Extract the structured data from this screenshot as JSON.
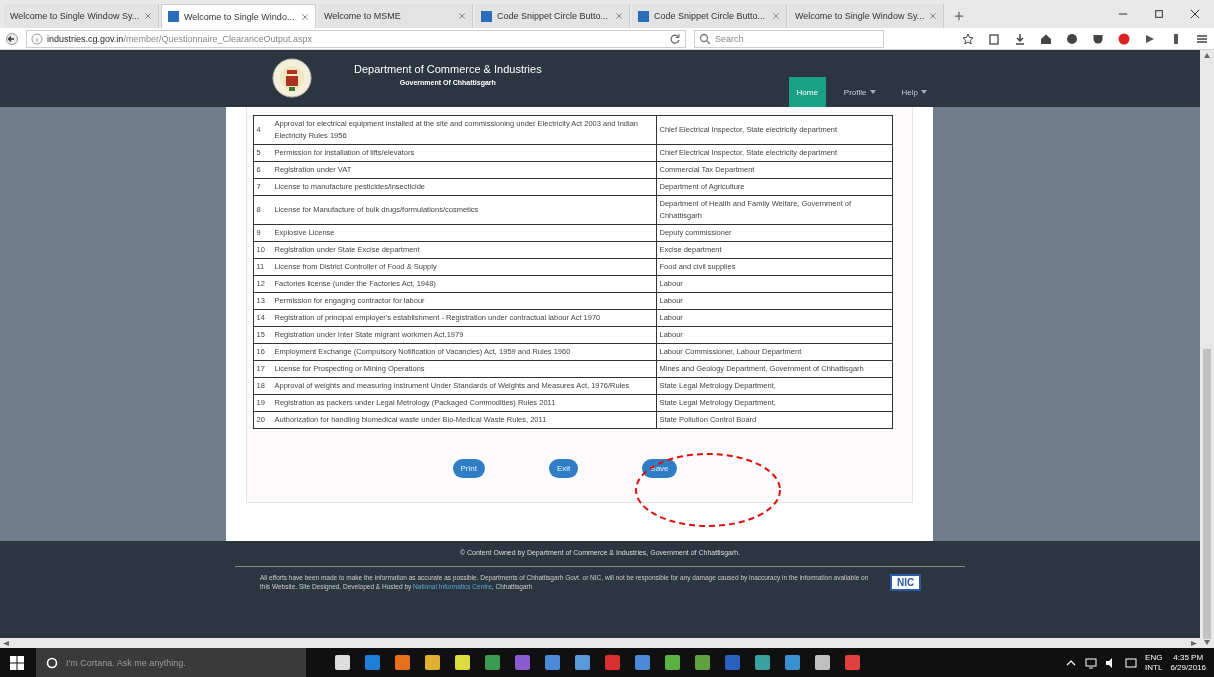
{
  "browser": {
    "tabs": [
      {
        "title": "Welcome to Single Window Sy...",
        "selected": false,
        "favicon": false
      },
      {
        "title": "Welcome to Single Windo...",
        "selected": true,
        "favicon": true
      },
      {
        "title": "Welcome to MSME",
        "selected": false,
        "favicon": false
      },
      {
        "title": "Code Snippet Circle Butto...",
        "selected": false,
        "favicon": true
      },
      {
        "title": "Code Snippet Circle Butto...",
        "selected": false,
        "favicon": true
      },
      {
        "title": "Welcome to Single Window Sy...",
        "selected": false,
        "favicon": false
      }
    ],
    "url_host": "industries.cg.gov.in",
    "url_path": "/member/Questionnaire_ClearanceOutput.aspx",
    "search_placeholder": "Search"
  },
  "header": {
    "title": "Department of Commerce & Industries",
    "subtitle": "Government Of Chhattisgarh",
    "nav": [
      {
        "label": "Home",
        "selected": true,
        "has_menu": false
      },
      {
        "label": "Profile",
        "selected": false,
        "has_menu": true
      },
      {
        "label": "Help",
        "selected": false,
        "has_menu": true
      }
    ]
  },
  "table": {
    "rows": [
      {
        "number": "4",
        "clearance": "Approval for electrical equipment installed at the site and commissioning under Electricity Act 2003 and Indian Electricity Rules 1956",
        "department": "Chief Electrical Inspector, State electricity department"
      },
      {
        "number": "5",
        "clearance": "Permission for installation of lifts/elevators",
        "department": "Chief Electrical Inspector, State electricity department"
      },
      {
        "number": "6",
        "clearance": "Registration under VAT",
        "department": "Commercial Tax Department"
      },
      {
        "number": "7",
        "clearance": "License to manufacture pesticides/insecticide",
        "department": "Department of Agriculture"
      },
      {
        "number": "8",
        "clearance": "License for Manufacture of bulk drugs/formulations/cosmetics",
        "department": "Department of Health and Family Welfare, Government of Chhattisgarh"
      },
      {
        "number": "9",
        "clearance": "Explosive License",
        "department": "Deputy commissioner"
      },
      {
        "number": "10",
        "clearance": "Registration under State Excise department",
        "department": "Excise department"
      },
      {
        "number": "11",
        "clearance": "License from District Controller of Food & Supply",
        "department": "Food and civil supplies"
      },
      {
        "number": "12",
        "clearance": "Factories license (under the Factories Act, 1948)",
        "department": "Labour"
      },
      {
        "number": "13",
        "clearance": "Permission for engaging contractor for labour",
        "department": "Labour"
      },
      {
        "number": "14",
        "clearance": "Registration of principal employer's establishment - Registration under contractual labour Act 1970",
        "department": "Labour"
      },
      {
        "number": "15",
        "clearance": "Registration under Inter State migrant workmen Act,1979",
        "department": "Labour"
      },
      {
        "number": "16",
        "clearance": "Employment Exchange (Compulsory Notification of Vacancies) Act, 1959 and Rules 1960",
        "department": "Labour Commissioner, Labour Department"
      },
      {
        "number": "17",
        "clearance": "License for Prospecting or Mining Operations",
        "department": "Mines and Geology Department, Government of Chhattisgarh"
      },
      {
        "number": "18",
        "clearance": "Approval of weights and measuring instrument Under Standards of Weights and Measures Act, 1976/Rules",
        "department": "State Legal Metrology Department,"
      },
      {
        "number": "19",
        "clearance": "Registration as packers under Legal Metrology (Packaged Commodities) Rules 2011",
        "department": "State Legal Metrology Department,"
      },
      {
        "number": "20",
        "clearance": "Authorization for handling biomedical waste under Bio-Medical Waste Rules, 2011",
        "department": "State Pollution Control Board"
      }
    ]
  },
  "buttons": [
    "Print",
    "Exit",
    "Save"
  ],
  "footer": {
    "copyright": "© Content Owned by Department of Commerce & Industries, Government of Chhattisgarh.",
    "disclaimer": "All efforts have been made to make the information as accurate as possible. Departments of Chhattisgarh Govt. or NIC, will not be responsible for any damage caused by inaccuracy in the information available on this Website. Site Designed, Developed & Hosted by",
    "link": "National Informatics Centre",
    "after_link": ", Chhattisgarh",
    "logo_text": "NIC"
  },
  "taskbar": {
    "search_placeholder": "I'm Cortana. Ask me anything.",
    "language": "ENG",
    "layout": "INTL",
    "time": "4:35 PM",
    "date": "6/29/2016"
  }
}
